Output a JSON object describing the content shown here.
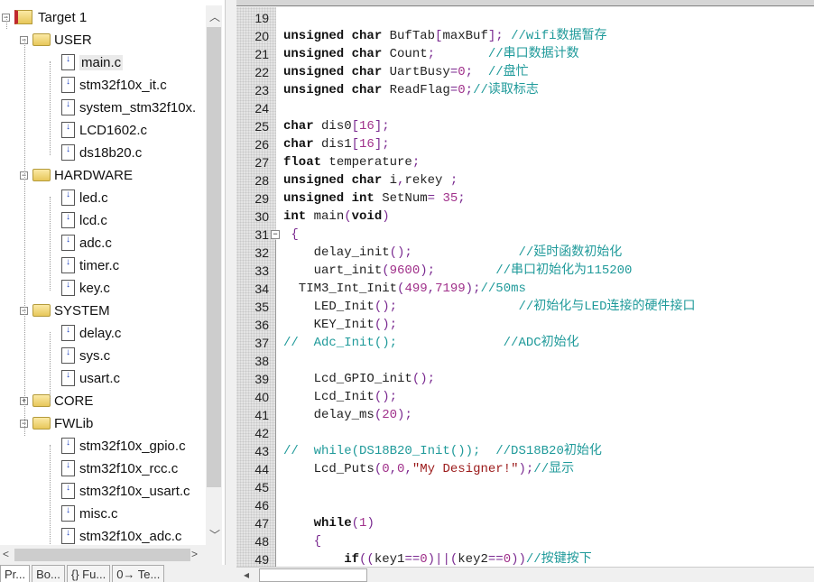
{
  "project_tree": {
    "items": [
      {
        "label": "Target 1",
        "type": "target",
        "level": 0,
        "expanded": true
      },
      {
        "label": "USER",
        "type": "folder",
        "level": 1,
        "expanded": true
      },
      {
        "label": "main.c",
        "type": "file",
        "level": 2,
        "selected": true
      },
      {
        "label": "stm32f10x_it.c",
        "type": "file",
        "level": 2
      },
      {
        "label": "system_stm32f10x.",
        "type": "file",
        "level": 2
      },
      {
        "label": "LCD1602.c",
        "type": "file",
        "level": 2
      },
      {
        "label": "ds18b20.c",
        "type": "file",
        "level": 2
      },
      {
        "label": "HARDWARE",
        "type": "folder",
        "level": 1,
        "expanded": true
      },
      {
        "label": "led.c",
        "type": "file",
        "level": 2
      },
      {
        "label": "lcd.c",
        "type": "file",
        "level": 2
      },
      {
        "label": "adc.c",
        "type": "file",
        "level": 2
      },
      {
        "label": "timer.c",
        "type": "file",
        "level": 2
      },
      {
        "label": "key.c",
        "type": "file",
        "level": 2
      },
      {
        "label": "SYSTEM",
        "type": "folder",
        "level": 1,
        "expanded": true
      },
      {
        "label": "delay.c",
        "type": "file",
        "level": 2
      },
      {
        "label": "sys.c",
        "type": "file",
        "level": 2
      },
      {
        "label": "usart.c",
        "type": "file",
        "level": 2
      },
      {
        "label": "CORE",
        "type": "folder",
        "level": 1,
        "expanded": false
      },
      {
        "label": "FWLib",
        "type": "folder",
        "level": 1,
        "expanded": true
      },
      {
        "label": "stm32f10x_gpio.c",
        "type": "file",
        "level": 2
      },
      {
        "label": "stm32f10x_rcc.c",
        "type": "file",
        "level": 2
      },
      {
        "label": "stm32f10x_usart.c",
        "type": "file",
        "level": 2
      },
      {
        "label": "misc.c",
        "type": "file",
        "level": 2
      },
      {
        "label": "stm32f10x_adc.c",
        "type": "file",
        "level": 2
      }
    ]
  },
  "bottom_tabs": [
    {
      "label": "Pr...",
      "icon": "project-icon",
      "active": true
    },
    {
      "label": "Bo...",
      "icon": "books-icon"
    },
    {
      "label": "{} Fu...",
      "icon": "functions-icon"
    },
    {
      "label": "0→ Te...",
      "icon": "templates-icon"
    }
  ],
  "editor": {
    "lines": [
      {
        "n": 19,
        "t": []
      },
      {
        "n": 20,
        "t": [
          [
            "k",
            "unsigned char "
          ],
          [
            "i",
            "BufTab"
          ],
          [
            "p",
            "["
          ],
          [
            "i",
            "maxBuf"
          ],
          [
            "p",
            "]; "
          ],
          [
            "c",
            "//wifi数据暂存"
          ]
        ]
      },
      {
        "n": 21,
        "t": [
          [
            "k",
            "unsigned char "
          ],
          [
            "i",
            "Count"
          ],
          [
            "p",
            ";       "
          ],
          [
            "c",
            "//串口数据计数"
          ]
        ]
      },
      {
        "n": 22,
        "t": [
          [
            "k",
            "unsigned char "
          ],
          [
            "i",
            "UartBusy"
          ],
          [
            "p",
            "="
          ],
          [
            "n",
            "0"
          ],
          [
            "p",
            ";  "
          ],
          [
            "c",
            "//盘忙"
          ]
        ]
      },
      {
        "n": 23,
        "t": [
          [
            "k",
            "unsigned char "
          ],
          [
            "i",
            "ReadFlag"
          ],
          [
            "p",
            "="
          ],
          [
            "n",
            "0"
          ],
          [
            "p",
            ";"
          ],
          [
            "c",
            "//读取标志"
          ]
        ]
      },
      {
        "n": 24,
        "t": []
      },
      {
        "n": 25,
        "t": [
          [
            "k",
            "char "
          ],
          [
            "i",
            "dis0"
          ],
          [
            "p",
            "["
          ],
          [
            "n",
            "16"
          ],
          [
            "p",
            "];"
          ]
        ]
      },
      {
        "n": 26,
        "t": [
          [
            "k",
            "char "
          ],
          [
            "i",
            "dis1"
          ],
          [
            "p",
            "["
          ],
          [
            "n",
            "16"
          ],
          [
            "p",
            "];"
          ]
        ]
      },
      {
        "n": 27,
        "t": [
          [
            "k",
            "float "
          ],
          [
            "i",
            "temperature"
          ],
          [
            "p",
            ";"
          ]
        ]
      },
      {
        "n": 28,
        "t": [
          [
            "k",
            "unsigned char "
          ],
          [
            "i",
            "i"
          ],
          [
            "p",
            ","
          ],
          [
            "i",
            "rekey "
          ],
          [
            "p",
            ";"
          ]
        ]
      },
      {
        "n": 29,
        "t": [
          [
            "k",
            "unsigned int "
          ],
          [
            "i",
            "SetNum"
          ],
          [
            "p",
            "= "
          ],
          [
            "n",
            "35"
          ],
          [
            "p",
            ";"
          ]
        ]
      },
      {
        "n": 30,
        "t": [
          [
            "k",
            "int "
          ],
          [
            "i",
            "main"
          ],
          [
            "p",
            "("
          ],
          [
            "k",
            "void"
          ],
          [
            "p",
            ")"
          ]
        ]
      },
      {
        "n": 31,
        "t": [
          [
            "p",
            " {"
          ]
        ]
      },
      {
        "n": 32,
        "t": [
          [
            "i",
            "    delay_init"
          ],
          [
            "p",
            "();              "
          ],
          [
            "c",
            "//延时函数初始化"
          ]
        ]
      },
      {
        "n": 33,
        "t": [
          [
            "i",
            "    uart_init"
          ],
          [
            "p",
            "("
          ],
          [
            "n",
            "9600"
          ],
          [
            "p",
            ");        "
          ],
          [
            "c",
            "//串口初始化为115200"
          ]
        ]
      },
      {
        "n": 34,
        "t": [
          [
            "i",
            "  TIM3_Int_Init"
          ],
          [
            "p",
            "("
          ],
          [
            "n",
            "499"
          ],
          [
            "p",
            ","
          ],
          [
            "n",
            "7199"
          ],
          [
            "p",
            ");"
          ],
          [
            "c",
            "//50ms"
          ]
        ]
      },
      {
        "n": 35,
        "t": [
          [
            "i",
            "    LED_Init"
          ],
          [
            "p",
            "();                "
          ],
          [
            "c",
            "//初始化与LED连接的硬件接口"
          ]
        ]
      },
      {
        "n": 36,
        "t": [
          [
            "i",
            "    KEY_Init"
          ],
          [
            "p",
            "();"
          ]
        ]
      },
      {
        "n": 37,
        "t": [
          [
            "c",
            "//  Adc_Init();              //ADC初始化"
          ]
        ]
      },
      {
        "n": 38,
        "t": []
      },
      {
        "n": 39,
        "t": [
          [
            "i",
            "    Lcd_GPIO_init"
          ],
          [
            "p",
            "();"
          ]
        ]
      },
      {
        "n": 40,
        "t": [
          [
            "i",
            "    Lcd_Init"
          ],
          [
            "p",
            "();"
          ]
        ]
      },
      {
        "n": 41,
        "t": [
          [
            "i",
            "    delay_ms"
          ],
          [
            "p",
            "("
          ],
          [
            "n",
            "20"
          ],
          [
            "p",
            ");"
          ]
        ]
      },
      {
        "n": 42,
        "t": []
      },
      {
        "n": 43,
        "t": [
          [
            "c",
            "//  while(DS18B20_Init());  //DS18B20初始化"
          ]
        ]
      },
      {
        "n": 44,
        "t": [
          [
            "i",
            "    Lcd_Puts"
          ],
          [
            "p",
            "("
          ],
          [
            "n",
            "0"
          ],
          [
            "p",
            ","
          ],
          [
            "n",
            "0"
          ],
          [
            "p",
            ","
          ],
          [
            "s",
            "\"My Designer!\""
          ],
          [
            "p",
            ");"
          ],
          [
            "c",
            "//显示"
          ]
        ]
      },
      {
        "n": 45,
        "t": []
      },
      {
        "n": 46,
        "t": []
      },
      {
        "n": 47,
        "t": [
          [
            "k",
            "    while"
          ],
          [
            "p",
            "("
          ],
          [
            "n",
            "1"
          ],
          [
            "p",
            ")"
          ]
        ]
      },
      {
        "n": 48,
        "t": [
          [
            "p",
            "    {"
          ]
        ]
      },
      {
        "n": 49,
        "t": [
          [
            "k",
            "        if"
          ],
          [
            "p",
            "(("
          ],
          [
            "i",
            "key1"
          ],
          [
            "p",
            "=="
          ],
          [
            "n",
            "0"
          ],
          [
            "p",
            ")||("
          ],
          [
            "i",
            "key2"
          ],
          [
            "p",
            "=="
          ],
          [
            "n",
            "0"
          ],
          [
            "p",
            "))"
          ],
          [
            "c",
            "//按键按下"
          ]
        ]
      }
    ]
  }
}
